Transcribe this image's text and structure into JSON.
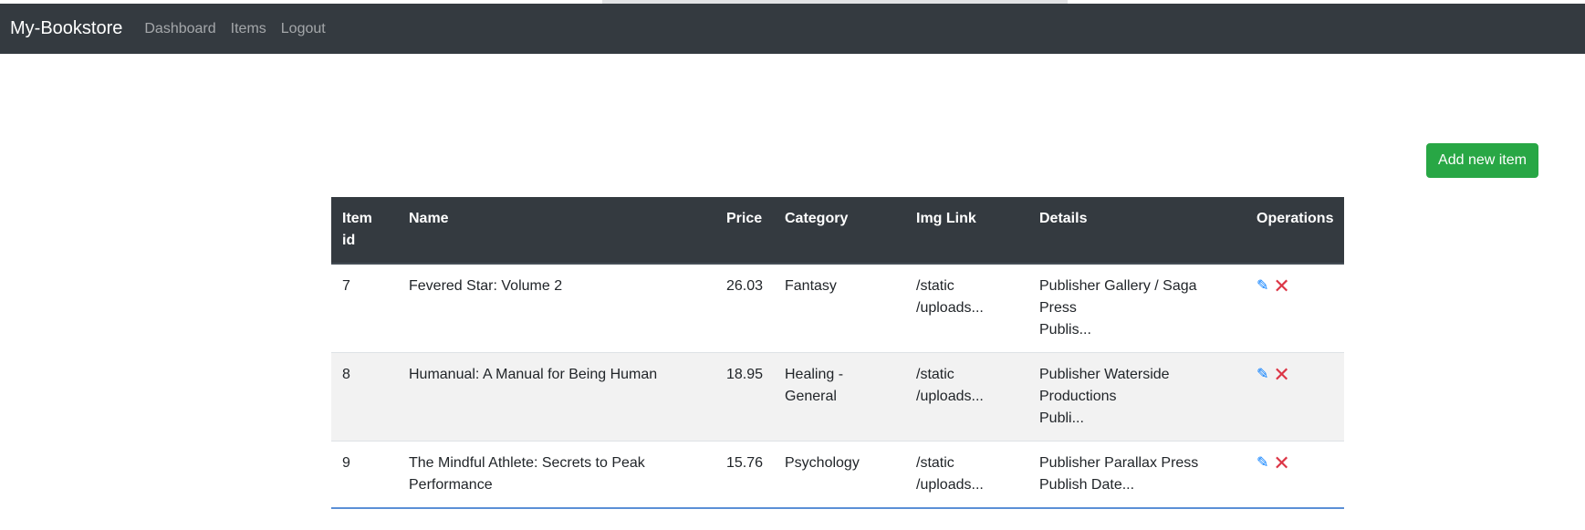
{
  "navbar": {
    "brand": "My-Bookstore",
    "links": [
      "Dashboard",
      "Items",
      "Logout"
    ]
  },
  "actions": {
    "add_label": "Add new item"
  },
  "table": {
    "headers": [
      "Item id",
      "Name",
      "Price",
      "Category",
      "Img Link",
      "Details",
      "Operations"
    ],
    "rows": [
      {
        "id": "7",
        "name": "Fevered Star: Volume 2",
        "price": "26.03",
        "category": "Fantasy",
        "img": "/static /uploads...",
        "details_1": "Publisher Gallery / Saga Press",
        "details_2": "Publis..."
      },
      {
        "id": "8",
        "name": "Humanual: A Manual for Being Human",
        "price": "18.95",
        "category": "Healing - General",
        "img": "/static /uploads...",
        "details_1": "Publisher Waterside Productions",
        "details_2": "Publi..."
      },
      {
        "id": "9",
        "name": "The Mindful Athlete: Secrets to Peak Performance",
        "price": "15.76",
        "category": "Psychology",
        "img": "/static /uploads...",
        "details_1": "Publisher Parallax Press",
        "details_2": "Publish Date..."
      }
    ],
    "edit_icon": "pencil-icon",
    "delete_icon": "x-icon"
  },
  "colors": {
    "navbar_bg": "#343a40",
    "add_button": "#28a745",
    "edit_icon": "#007bff",
    "delete_icon": "#dc3545"
  }
}
